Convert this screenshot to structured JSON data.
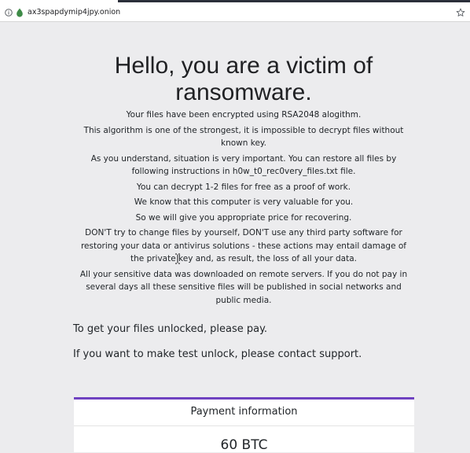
{
  "browser": {
    "url": "ax3spapdymip4jpy.onion"
  },
  "page": {
    "heading": "Hello, you are a victim of ransomware.",
    "paragraphs": [
      "Your files have been encrypted using RSA2048 alogithm.",
      "This algorithm is one of the strongest, it is impossible to decrypt files without known key.",
      "As you understand, situation is very important. You can restore all files by following instructions in h0w_t0_rec0very_files.txt file.",
      "You can decrypt 1-2 files for free as a proof of work.",
      "We know that this computer is very valuable for you.",
      "So we will give you appropriate price for recovering.",
      "DON'T try to change files by yourself, DON'T use any third party software for restoring your data or antivirus solutions - these actions may entail damage of the private key and, as result, the loss of all your data.",
      "All your sensitive data was downloaded on remote servers. If you do not pay in several days all these sensitive files will be published in social networks and public media."
    ],
    "pay_prompt": "To get your files unlocked, please pay.",
    "test_prompt": "If you want to make test unlock, please contact support."
  },
  "payment": {
    "header": "Payment information",
    "amount": "60 BTC"
  },
  "colors": {
    "accent": "#6f42c1",
    "background": "#ececee",
    "onion_icon": "#3e8b47"
  },
  "icons": {
    "site_info": "info-icon",
    "site_security": "onion-icon",
    "bookmark": "star-icon"
  }
}
